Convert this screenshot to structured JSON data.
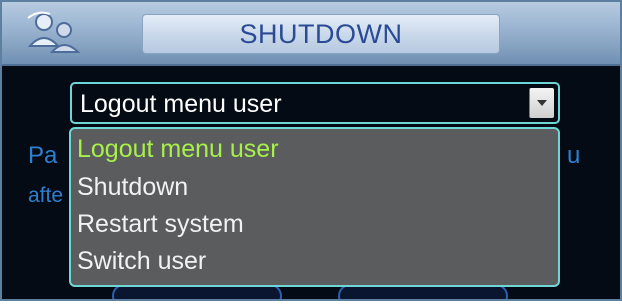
{
  "title": "SHUTDOWN",
  "title_icon": "users-icon",
  "background_text": {
    "line1_left": "Pa",
    "line1_right": "u",
    "line2_left": "afte"
  },
  "select": {
    "value": "Logout menu user",
    "arrow_icon": "chevron-down-icon"
  },
  "dropdown": {
    "options": [
      {
        "label": "Logout menu user",
        "selected": true
      },
      {
        "label": "Shutdown",
        "selected": false
      },
      {
        "label": "Restart system",
        "selected": false
      },
      {
        "label": "Switch user",
        "selected": false
      }
    ]
  },
  "colors": {
    "accent_cyan": "#6fd6d6",
    "selected_option": "#a8f04a",
    "title_text": "#2a4a96",
    "body_text": "#2f7fd0"
  }
}
